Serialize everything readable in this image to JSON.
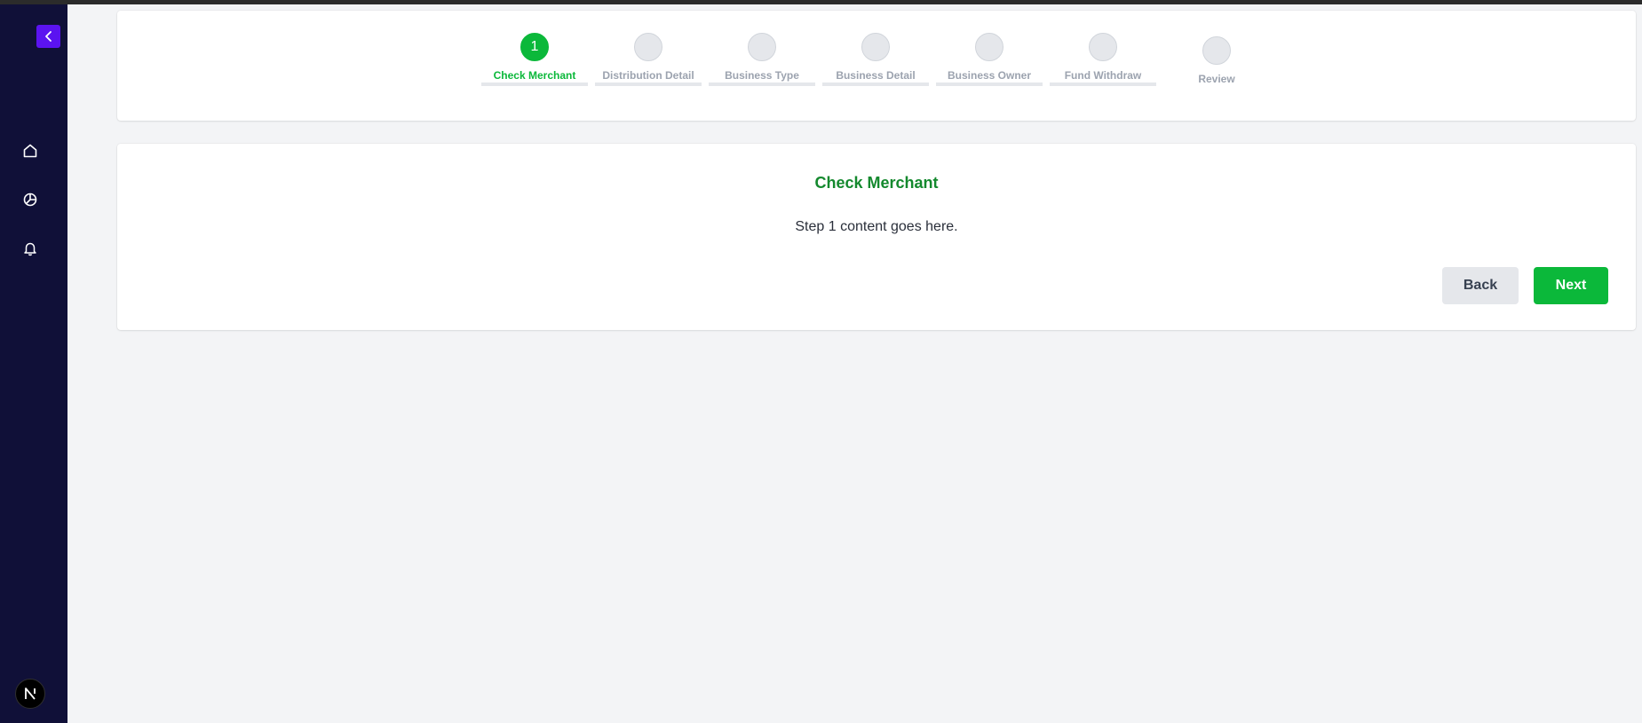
{
  "sidebar": {
    "collapse_icon": "chevron-left-icon",
    "nav": [
      {
        "name": "home",
        "icon": "home-icon"
      },
      {
        "name": "explore",
        "icon": "explore-icon"
      },
      {
        "name": "notifications",
        "icon": "bell-icon"
      }
    ],
    "avatar_letter": "N"
  },
  "stepper": {
    "current_step": 1,
    "steps": [
      {
        "number": "1",
        "label": "Check Merchant"
      },
      {
        "number": "",
        "label": "Distribution Detail"
      },
      {
        "number": "",
        "label": "Business Type"
      },
      {
        "number": "",
        "label": "Business Detail"
      },
      {
        "number": "",
        "label": "Business Owner"
      },
      {
        "number": "",
        "label": "Fund Withdraw"
      },
      {
        "number": "",
        "label": "Review"
      }
    ]
  },
  "content": {
    "title": "Check Merchant",
    "text": "Step 1 content goes here.",
    "back_label": "Back",
    "next_label": "Next"
  },
  "colors": {
    "sidebar_bg": "#101038",
    "accent_purple": "#5b13f0",
    "accent_green": "#0bb83a",
    "title_green": "#14892e",
    "page_bg": "#f3f4f6"
  }
}
